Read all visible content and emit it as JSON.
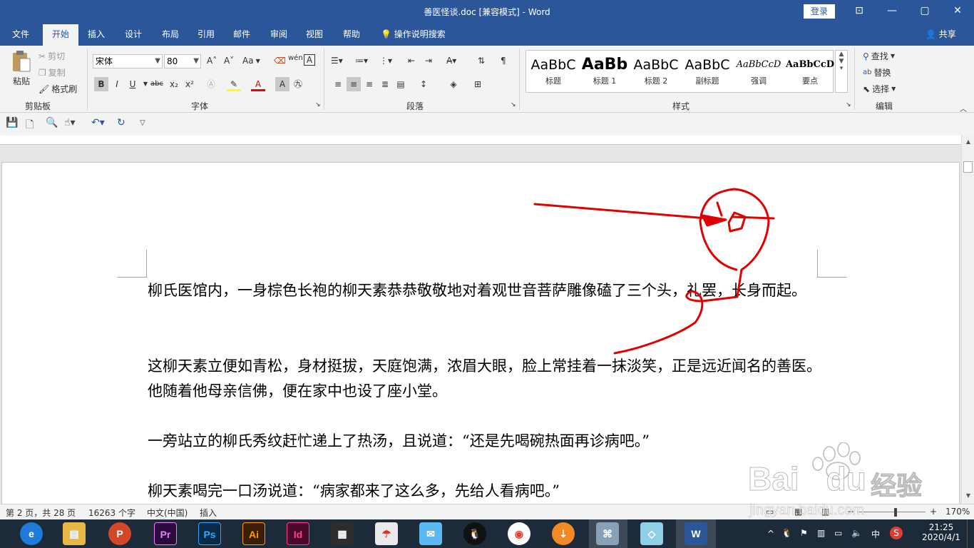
{
  "window": {
    "title": "善医怪谈.doc [兼容模式]  -  Word",
    "login": "登录",
    "min": "—",
    "restore": "▢",
    "close": "✕",
    "ribbon_display": "⊡"
  },
  "tabs": [
    "文件",
    "开始",
    "插入",
    "设计",
    "布局",
    "引用",
    "邮件",
    "审阅",
    "视图",
    "帮助"
  ],
  "active_tab": "开始",
  "tell_me": "操作说明搜索",
  "share": "共享",
  "clipboard": {
    "paste": "粘贴",
    "cut": "剪切",
    "copy": "复制",
    "format_painter": "格式刷",
    "label": "剪贴板"
  },
  "font": {
    "name": "宋体",
    "size": "80",
    "label": "字体",
    "grow": "A˄",
    "shrink": "A˅",
    "case": "Aa",
    "phonetic": "wén",
    "bold": "B",
    "italic": "I",
    "underline": "U",
    "strike": "abc",
    "subscript": "x₂",
    "superscript": "x²"
  },
  "paragraph": {
    "label": "段落"
  },
  "styles": {
    "label": "样式",
    "items": [
      {
        "sample": "AaBbC",
        "name": "标题"
      },
      {
        "sample": "AaBb",
        "name": "标题 1"
      },
      {
        "sample": "AaBbC",
        "name": "标题 2"
      },
      {
        "sample": "AaBbC",
        "name": "副标题"
      },
      {
        "sample": "AaBbCcD",
        "name": "强调"
      },
      {
        "sample": "AaBbCcD",
        "name": "要点"
      }
    ]
  },
  "editing": {
    "find": "查找",
    "replace": "替换",
    "select": "选择",
    "label": "编辑"
  },
  "document": {
    "paragraphs": [
      "柳氏医馆内，一身棕色长袍的柳天素恭恭敬敬地对着观世音菩萨雕像磕了三个头，礼罢，长身而起。",
      "这柳天素立便如青松，身材挺拔，天庭饱满，浓眉大眼，脸上常挂着一抹淡笑，正是远近闻名的善医。他随着他母亲信佛，便在家中也设了座小堂。",
      "一旁站立的柳氏秀纹赶忙递上了热汤，且说道：“还是先喝碗热面再诊病吧。”",
      "柳天素喝完一口汤说道：“病家都来了这么多，先给人看病吧。”"
    ]
  },
  "status": {
    "page": "第 2 页，共 28 页",
    "words": "16263 个字",
    "language": "中文(中国)",
    "mode": "插入",
    "zoom_minus": "−",
    "zoom_plus": "+",
    "zoom": "170%"
  },
  "taskbar": {
    "apps": [
      {
        "name": "PowerPoint",
        "label": "P",
        "color": "#d24726"
      },
      {
        "name": "Premiere",
        "label": "Pr",
        "color": "#2a0b3b"
      },
      {
        "name": "Photoshop",
        "label": "Ps",
        "color": "#0b2a4a"
      },
      {
        "name": "Illustrator",
        "label": "Ai",
        "color": "#3a1e05"
      },
      {
        "name": "InDesign",
        "label": "Id",
        "color": "#4a0a2a"
      },
      {
        "name": "Word",
        "label": "W",
        "color": "#2b579a"
      }
    ],
    "ime": "中",
    "time": "21:25",
    "date": "2020/4/1"
  },
  "watermark": {
    "brand": "Bai",
    "brand2": "du",
    "cn": "经验",
    "url": "jingyan.baidu.com"
  },
  "colors": {
    "word_blue": "#2b579a",
    "annotation_red": "#e00000"
  }
}
